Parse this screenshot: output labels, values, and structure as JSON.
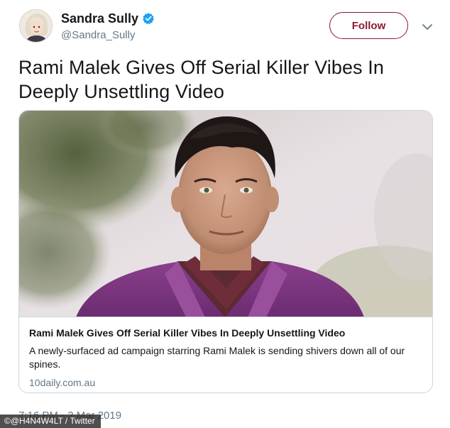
{
  "author": {
    "display_name": "Sandra Sully",
    "handle": "@Sandra_Sully",
    "verified": true,
    "avatar_icon": "cartoon-avatar-icon"
  },
  "actions": {
    "follow_label": "Follow",
    "more_icon": "chevron-down-icon"
  },
  "tweet": {
    "text": "Rami Malek Gives Off Serial Killer Vibes In Deeply Unsettling Video",
    "timestamp": "7:16 PM - 2 Mar 2019"
  },
  "card": {
    "title": "Rami Malek Gives Off Serial Killer Vibes In Deeply Unsettling Video",
    "description": "A newly-surfaced ad campaign starring Rami Malek is sending shivers down all of our spines.",
    "domain": "10daily.com.au"
  },
  "watermark": "©@H4N4W4LT / Twitter",
  "colors": {
    "follow": "#8a1a2e",
    "verified": "#1da1f2",
    "muted": "#657786",
    "border": "#ccd6dd"
  }
}
